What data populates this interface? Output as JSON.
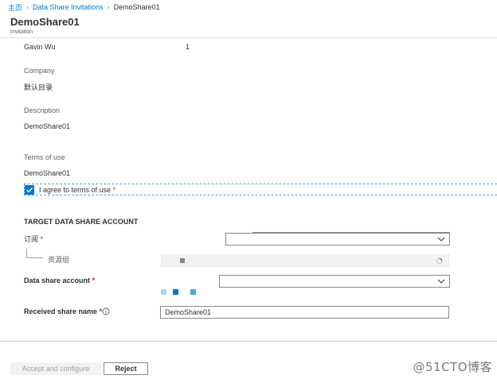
{
  "breadcrumb": {
    "home": "主页",
    "parent": "Data Share Invitations",
    "current": "DemoShare01"
  },
  "header": {
    "title": "DemoShare01",
    "subtitle": "Invitation"
  },
  "details": {
    "sender_name": "Gavin Wu",
    "sender_count": "1",
    "company_label": "Company",
    "company_value": "默认目录",
    "description_label": "Description",
    "description_value": "DemoShare01",
    "terms_label": "Terms of use",
    "terms_value": "DemoShare01"
  },
  "agree": {
    "label": "I agree to terms of use",
    "required_mark": "*",
    "checked": true
  },
  "target": {
    "section_title": "TARGET DATA SHARE ACCOUNT",
    "subscription_label": "订阅",
    "subscription_value": "",
    "resource_group_label": "资源组",
    "account_label": "Data share account",
    "account_value": "",
    "received_name_label": "Received share name",
    "received_name_value": "DemoShare01",
    "required_mark": "*"
  },
  "footer": {
    "accept_label": "Accept and configure",
    "reject_label": "Reject"
  },
  "watermark": "@51CTO博客",
  "colors": {
    "accent": "#0078d4",
    "required": "#a4262c",
    "dashed_focus": "#4aa6e0"
  }
}
